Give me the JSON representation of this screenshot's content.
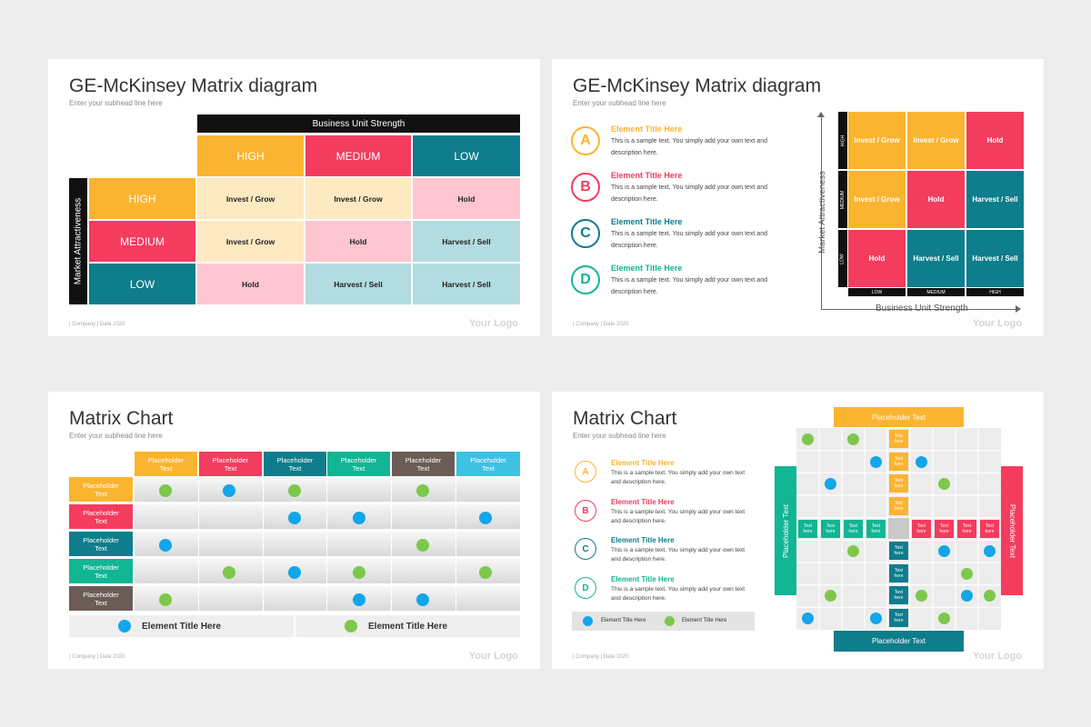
{
  "colors": {
    "yellow": "#FBB430",
    "red": "#F33C5E",
    "teal": "#0E7D8C",
    "green": "#12B594",
    "brown": "#6B5C55",
    "cyan": "#3EC1E3",
    "ldot_blue": "#13A6E8",
    "ldot_green": "#7DC84A"
  },
  "slide1": {
    "title": "GE-McKinsey Matrix diagram",
    "subtitle": "Enter your subhead line here",
    "bus": "Business Unit Strength",
    "market": "Market Attractiveness",
    "cols": [
      "HIGH",
      "MEDIUM",
      "LOW"
    ],
    "rows": [
      "HIGH",
      "MEDIUM",
      "LOW"
    ],
    "cells": [
      [
        "Invest / Grow",
        "Invest / Grow",
        "Hold"
      ],
      [
        "Invest / Grow",
        "Hold",
        "Harvest / Sell"
      ],
      [
        "Hold",
        "Harvest / Sell",
        "Harvest / Sell"
      ]
    ],
    "footer": "| Company  | Date 2020",
    "logo": "Your Logo"
  },
  "slide2": {
    "title": "GE-McKinsey Matrix diagram",
    "subtitle": "Enter your subhead line here",
    "items": [
      {
        "letter": "A",
        "title": "Element Title Here",
        "desc1": "This is a sample text. You simply add your own text and",
        "desc2": "description here."
      },
      {
        "letter": "B",
        "title": "Element Title Here",
        "desc1": "This is a sample text. You simply add your own text and",
        "desc2": "description here."
      },
      {
        "letter": "C",
        "title": "Element Title Here",
        "desc1": "This is a sample text. You simply add your own text and",
        "desc2": "description here."
      },
      {
        "letter": "D",
        "title": "Element Title Here",
        "desc1": "This is a sample text. You simply add your own text and",
        "desc2": "description here."
      }
    ],
    "market": "Market Attractiveness",
    "bus": "Business Unit Strength",
    "rows": [
      "HIGH",
      "MEDIUM",
      "LOW"
    ],
    "cols": [
      "LOW",
      "MEDIUM",
      "HIGH"
    ],
    "cells": [
      [
        "Invest / Grow",
        "Invest / Grow",
        "Hold"
      ],
      [
        "Invest / Grow",
        "Hold",
        "Harvest / Sell"
      ],
      [
        "Hold",
        "Harvest / Sell",
        "Harvest / Sell"
      ]
    ],
    "footer": "| Company  | Date 2020",
    "logo": "Your Logo"
  },
  "slide3": {
    "title": "Matrix Chart",
    "subtitle": "Enter your subhead line here",
    "cols": [
      "Placeholder Text",
      "Placeholder Text",
      "Placeholder Text",
      "Placeholder Text",
      "Placeholder Text",
      "Placeholder Text"
    ],
    "rows": [
      "Placeholder Text",
      "Placeholder Text",
      "Placeholder Text",
      "Placeholder Text",
      "Placeholder Text"
    ],
    "dots": [
      [
        "g",
        "b",
        "g",
        "",
        "g",
        ""
      ],
      [
        "",
        "",
        "b",
        "b",
        "",
        "b"
      ],
      [
        "b",
        "",
        "",
        "",
        "g",
        ""
      ],
      [
        "",
        "g",
        "b",
        "g",
        "",
        "g"
      ],
      [
        "g",
        "",
        "",
        "b",
        "b",
        ""
      ]
    ],
    "legend": [
      "Element Title Here",
      "Element Title Here"
    ],
    "footer": "| Company  | Date 2020",
    "logo": "Your Logo"
  },
  "slide4": {
    "title": "Matrix Chart",
    "subtitle": "Enter your subhead line here",
    "items": [
      {
        "letter": "A",
        "title": "Element Title Here",
        "desc1": "This is a sample text. You simply add your own text",
        "desc2": "and description here."
      },
      {
        "letter": "B",
        "title": "Element Title Here",
        "desc1": "This is a sample text. You simply add your own text",
        "desc2": "and description here."
      },
      {
        "letter": "C",
        "title": "Element Title Here",
        "desc1": "This is a sample text. You simply add your own text",
        "desc2": "and description here."
      },
      {
        "letter": "D",
        "title": "Element Title Here",
        "desc1": "This is a sample text. You simply add your own text",
        "desc2": "and description here."
      }
    ],
    "legend": [
      "Element Title Here",
      "Element Title Here"
    ],
    "top": "Placeholder Text",
    "bottom": "Placeholder Text",
    "left": "Placeholder Text",
    "right": "Placeholder Text",
    "tag": "Text here",
    "footer": "| Company  | Date 2020",
    "logo": "Your Logo"
  }
}
